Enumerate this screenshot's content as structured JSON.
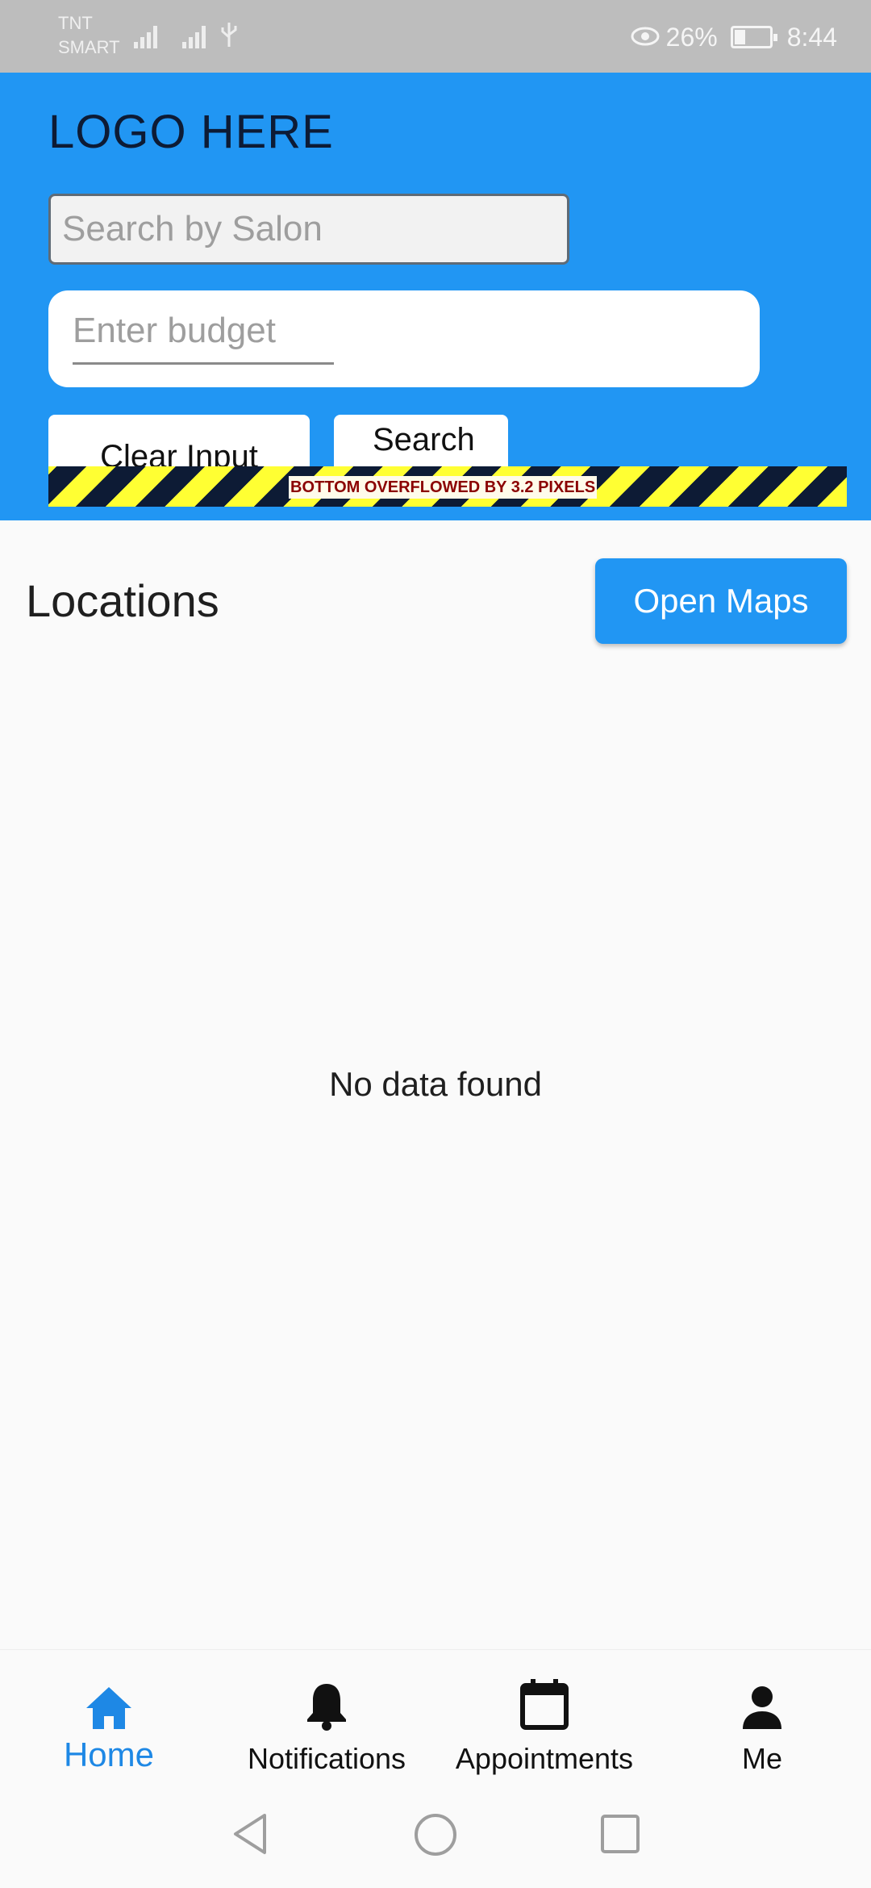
{
  "status_bar": {
    "carrier_line1": "TNT",
    "carrier_line2": "SMART",
    "battery_percent": "26%",
    "time": "8:44",
    "icons": [
      "signal-icon",
      "signal-icon",
      "usb-icon",
      "eye-icon",
      "battery-charging-icon"
    ]
  },
  "header": {
    "logo": "LOGO HERE",
    "search_placeholder": "Search by Salon",
    "budget_placeholder": "Enter budget",
    "clear_button": "Clear Input",
    "search_button": "Search",
    "overflow_warning": "BOTTOM OVERFLOWED BY 3.2 PIXELS",
    "background_color": "#2196f3"
  },
  "main": {
    "section_title": "Locations",
    "open_maps_button": "Open Maps",
    "empty_message": "No data found"
  },
  "bottom_nav": {
    "active_index": 0,
    "items": [
      {
        "label": "Home",
        "icon": "home-icon"
      },
      {
        "label": "Notifications",
        "icon": "bell-icon"
      },
      {
        "label": "Appointments",
        "icon": "calendar-icon"
      },
      {
        "label": "Me",
        "icon": "person-icon"
      }
    ],
    "active_color": "#1e88e5"
  },
  "system_nav": {
    "icons": [
      "back-icon",
      "home-circle-icon",
      "recents-icon"
    ]
  }
}
